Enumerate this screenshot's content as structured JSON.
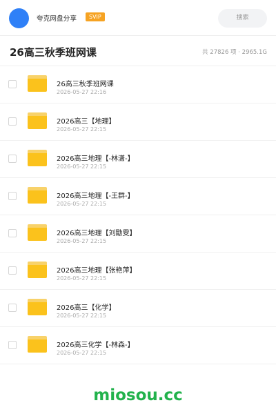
{
  "header": {
    "username": "夸克网盘分享",
    "badge": "SVIP",
    "search_placeholder": "搜索",
    "colors": {
      "avatar": "#2f80f7",
      "badge": "#f6a323"
    }
  },
  "folder": {
    "title": "26高三秋季班网课",
    "stats": "共 27826 项 · 2965.1G"
  },
  "items": [
    {
      "name": "26高三秋季班网课",
      "date": "2026-05-27 22:16",
      "icon": "folder-icon"
    },
    {
      "name": "2026高三【地理】",
      "date": "2026-05-27 22:15",
      "icon": "folder-icon"
    },
    {
      "name": "2026高三地理【-林潇-】",
      "date": "2026-05-27 22:15",
      "icon": "folder-icon"
    },
    {
      "name": "2026高三地理【-王群-】",
      "date": "2026-05-27 22:15",
      "icon": "folder-icon"
    },
    {
      "name": "2026高三地理【刘勖雯】",
      "date": "2026-05-27 22:15",
      "icon": "folder-icon"
    },
    {
      "name": "2026高三地理【张艳萍】",
      "date": "2026-05-27 22:15",
      "icon": "folder-icon"
    },
    {
      "name": "2026高三【化学】",
      "date": "2026-05-27 22:15",
      "icon": "folder-icon"
    },
    {
      "name": "2026高三化学【-林森-】",
      "date": "2026-05-27 22:15",
      "icon": "folder-icon"
    }
  ],
  "watermark": "miosou.cc"
}
